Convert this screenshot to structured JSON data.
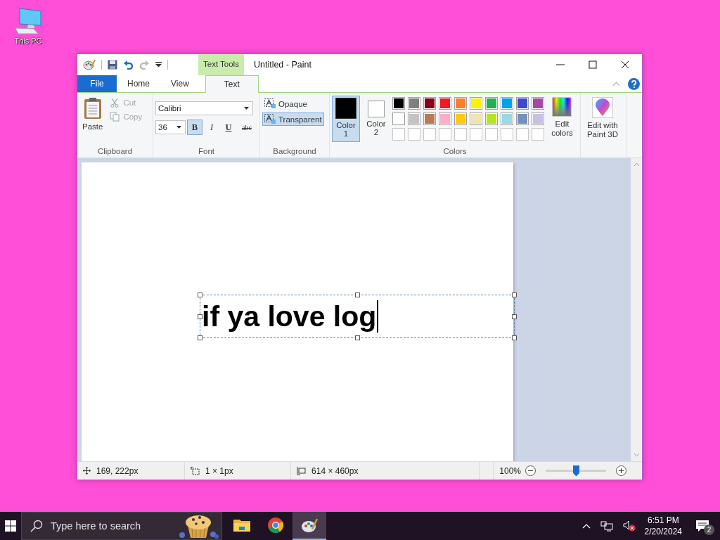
{
  "desktop_icons": [
    {
      "label": "This PC"
    }
  ],
  "window": {
    "title": "Untitled - Paint",
    "contextual_tab": "Text Tools"
  },
  "tabs": [
    {
      "label": "File",
      "kind": "file",
      "selected": false
    },
    {
      "label": "Home",
      "kind": "tab",
      "selected": false
    },
    {
      "label": "View",
      "kind": "tab",
      "selected": false
    },
    {
      "label": "Text",
      "kind": "tab",
      "selected": true
    }
  ],
  "clipboard": {
    "label": "Clipboard",
    "paste": "Paste",
    "cut": {
      "label": "Cut",
      "disabled": true
    },
    "copy": {
      "label": "Copy",
      "disabled": true
    }
  },
  "font": {
    "label": "Font",
    "family": "Calibri",
    "size": "36",
    "styles": [
      {
        "label": "B",
        "kind": "bold",
        "selected": true
      },
      {
        "label": "I",
        "kind": "italic",
        "selected": false
      },
      {
        "label": "U",
        "kind": "underline",
        "selected": false
      },
      {
        "label": "abc",
        "kind": "strike",
        "selected": false
      }
    ]
  },
  "background": {
    "label": "Background",
    "options": [
      {
        "label": "Opaque",
        "selected": false
      },
      {
        "label": "Transparent",
        "selected": true
      }
    ]
  },
  "colors": {
    "label": "Colors",
    "slots": [
      {
        "label": "Color 1",
        "color": "#000000",
        "selected": true
      },
      {
        "label": "Color 2",
        "color": "#ffffff",
        "selected": false
      }
    ],
    "palette": [
      {
        "color": "#000000"
      },
      {
        "color": "#7f7f7f"
      },
      {
        "color": "#880015"
      },
      {
        "color": "#ed1c24"
      },
      {
        "color": "#ff7f27"
      },
      {
        "color": "#fff200"
      },
      {
        "color": "#22b14c"
      },
      {
        "color": "#00a2e8"
      },
      {
        "color": "#3f48cc"
      },
      {
        "color": "#a349a4"
      },
      {
        "color": "#ffffff"
      },
      {
        "color": "#c3c3c3"
      },
      {
        "color": "#b97a57"
      },
      {
        "color": "#ffaec9"
      },
      {
        "color": "#ffc90e"
      },
      {
        "color": "#efe4b0"
      },
      {
        "color": "#b5e61d"
      },
      {
        "color": "#99d9ea"
      },
      {
        "color": "#7092be"
      },
      {
        "color": "#c8bfe7"
      }
    ],
    "edit_colors": "Edit colors"
  },
  "paint3d": {
    "label": "Edit with Paint 3D"
  },
  "canvas": {
    "text": "if ya love log"
  },
  "status_bar": {
    "cursor": "169, 222px",
    "selection": "1 × 1px",
    "size": "614 × 460px",
    "zoom": "100%",
    "level": 0.5
  },
  "taskbar": {
    "search_placeholder": "Type here to search",
    "apps": [
      {
        "kind": "explorer",
        "selected": false
      },
      {
        "kind": "chrome",
        "selected": false
      },
      {
        "kind": "paint",
        "selected": true
      }
    ],
    "time": "6:51 PM",
    "date": "2/20/2024",
    "notifications": "2"
  }
}
